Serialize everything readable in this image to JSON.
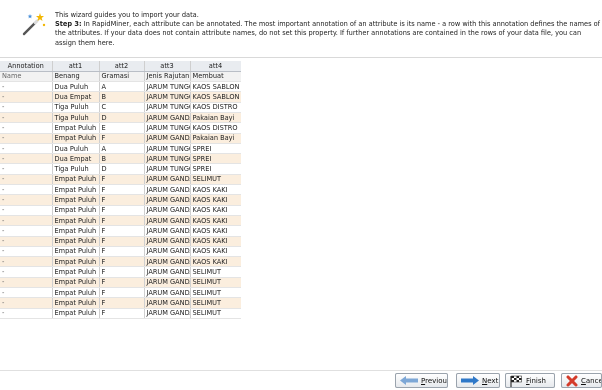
{
  "intro": {
    "line1": "This wizard guides you to import your data.",
    "step_label": "Step 3:",
    "line2_rest": " In RapidMiner, each attribute can be annotated. The most important annotation of an attribute is its name - a row with this annotation defines the names of",
    "line3": "the attributes. If your data does not contain attribute names, do not set this property. If further annotations are contained in the rows of your data file, you can",
    "line4": "assign them here."
  },
  "table": {
    "columns": [
      "Annotation",
      "att1",
      "att2",
      "att3",
      "att4"
    ],
    "name_row": [
      "Name",
      "Benang",
      "Gramasi",
      "Jenis Rajutan",
      "Membuat"
    ],
    "rows": [
      [
        "-",
        "Dua Puluh",
        "A",
        "JARUM TUNGGAL",
        "KAOS SABLON"
      ],
      [
        "-",
        "Dua Empat",
        "B",
        "JARUM TUNGGAL",
        "KAOS SABLON"
      ],
      [
        "-",
        "Tiga Puluh",
        "C",
        "JARUM TUNGGAL",
        "KAOS DISTRO"
      ],
      [
        "-",
        "Tiga Puluh",
        "D",
        "JARUM GANDA",
        "Pakaian Bayi"
      ],
      [
        "-",
        "Empat Puluh",
        "E",
        "JARUM TUNGGAL",
        "KAOS DISTRO"
      ],
      [
        "-",
        "Empat Puluh",
        "F",
        "JARUM GANDA",
        "Pakaian Bayi"
      ],
      [
        "-",
        "Dua Puluh",
        "A",
        "JARUM TUNGGAL",
        "SPREI"
      ],
      [
        "-",
        "Dua Empat",
        "B",
        "JARUM TUNGGAL",
        "SPREI"
      ],
      [
        "-",
        "Tiga Puluh",
        "D",
        "JARUM TUNGGAL",
        "SPREI"
      ],
      [
        "-",
        "Empat Puluh",
        "F",
        "JARUM GANDA",
        "SELIMUT"
      ],
      [
        "-",
        "Empat Puluh",
        "F",
        "JARUM GANDA",
        "KAOS KAKI"
      ],
      [
        "-",
        "Empat Puluh",
        "F",
        "JARUM GANDA",
        "KAOS KAKI"
      ],
      [
        "-",
        "Empat Puluh",
        "F",
        "JARUM GANDA",
        "KAOS KAKI"
      ],
      [
        "-",
        "Empat Puluh",
        "F",
        "JARUM GANDA",
        "KAOS KAKI"
      ],
      [
        "-",
        "Empat Puluh",
        "F",
        "JARUM GANDA",
        "KAOS KAKI"
      ],
      [
        "-",
        "Empat Puluh",
        "F",
        "JARUM GANDA",
        "KAOS KAKI"
      ],
      [
        "-",
        "Empat Puluh",
        "F",
        "JARUM GANDA",
        "KAOS KAKI"
      ],
      [
        "-",
        "Empat Puluh",
        "F",
        "JARUM GANDA",
        "KAOS KAKI"
      ],
      [
        "-",
        "Empat Puluh",
        "F",
        "JARUM GANDA",
        "SELIMUT"
      ],
      [
        "-",
        "Empat Puluh",
        "F",
        "JARUM GANDA",
        "SELIMUT"
      ],
      [
        "-",
        "Empat Puluh",
        "F",
        "JARUM GANDA",
        "SELIMUT"
      ],
      [
        "-",
        "Empat Puluh",
        "F",
        "JARUM GANDA",
        "SELIMUT"
      ],
      [
        "-",
        "Empat Puluh",
        "F",
        "JARUM GANDA",
        "SELIMUT"
      ]
    ]
  },
  "buttons": {
    "previous": {
      "first": "P",
      "rest": "revious"
    },
    "next": {
      "first": "N",
      "rest": "ext"
    },
    "finish": {
      "first": "F",
      "rest": "inish"
    },
    "cancel": {
      "first": "C",
      "rest": "ancel"
    }
  },
  "colors": {
    "row_stripe": "#fbeede",
    "header_bg": "#e9ecf0",
    "next_arrow": "#2f78c8",
    "cancel_x": "#d43b2a"
  },
  "icons": {
    "wizard": "magic-wand-icon",
    "previous": "arrow-left-icon",
    "next": "arrow-right-icon",
    "finish": "checkered-flag-icon",
    "cancel": "red-x-icon"
  }
}
